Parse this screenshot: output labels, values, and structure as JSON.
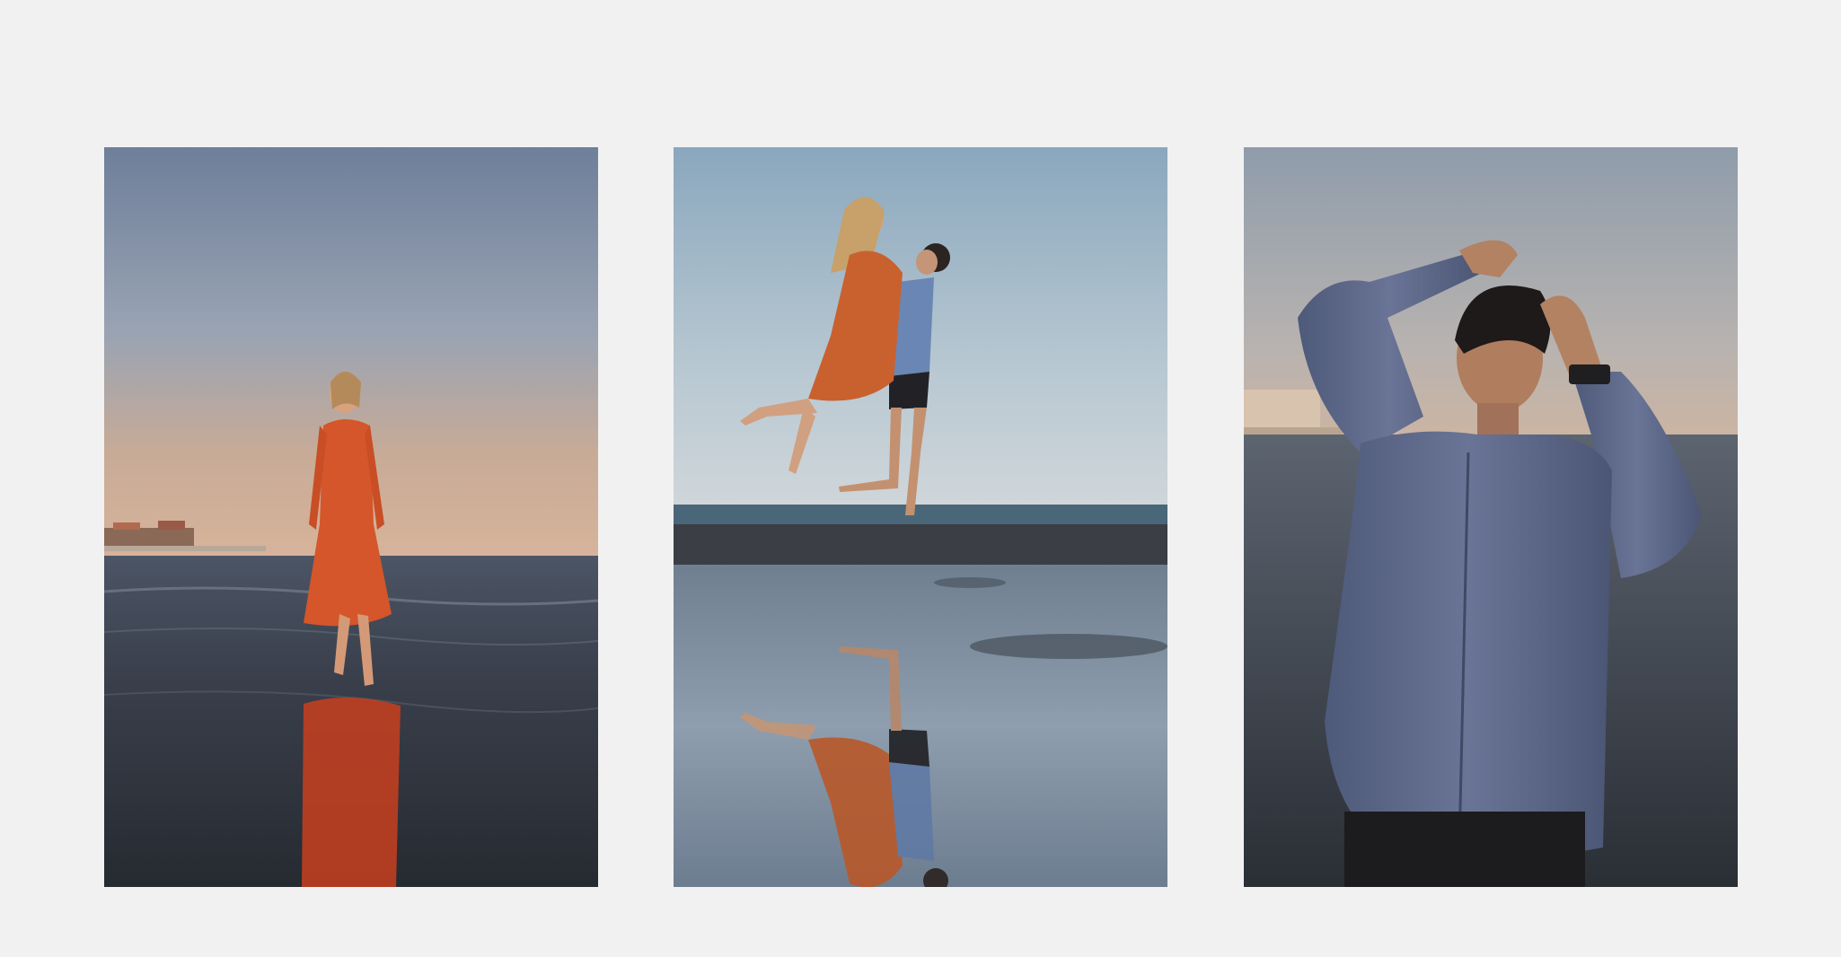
{
  "gallery": {
    "photos": [
      {
        "subject": "woman-in-orange-dress-walking-on-beach",
        "accent": "#d4562a"
      },
      {
        "subject": "couple-embracing-on-wet-sand-with-reflection",
        "accent": "#c9612f"
      },
      {
        "subject": "man-in-blue-shirt-hands-on-head",
        "accent": "#5b6688"
      }
    ],
    "background": "#f1f1f1"
  }
}
